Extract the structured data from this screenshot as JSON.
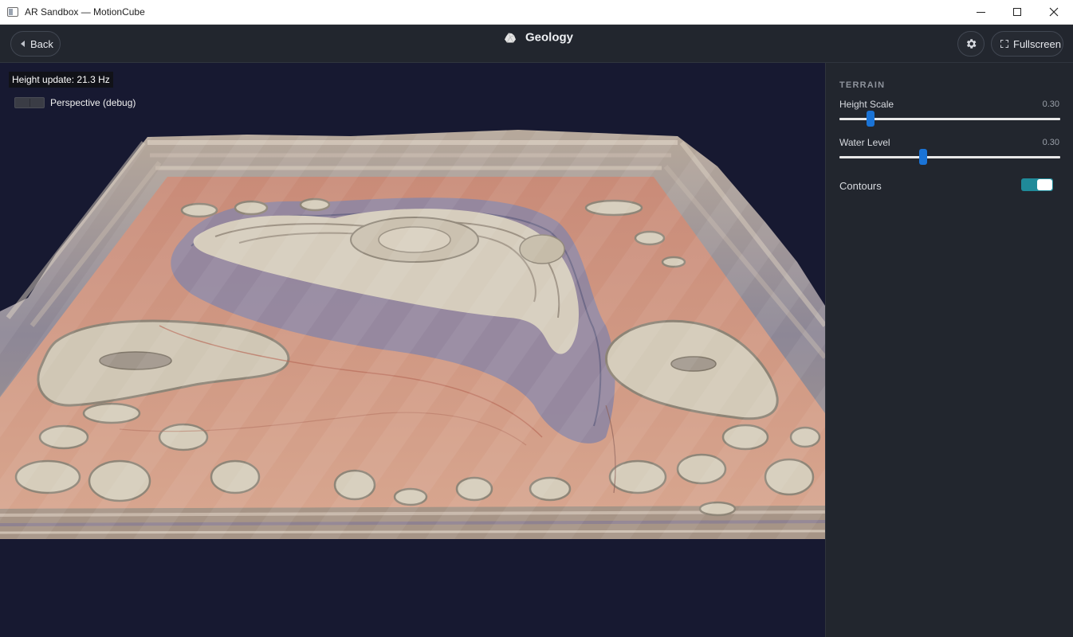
{
  "window": {
    "title": "AR Sandbox — MotionCube"
  },
  "header": {
    "back_label": "Back",
    "title": "Geology",
    "title_icon": "rock-icon",
    "settings_icon": "gear-icon",
    "fullscreen_label": "Fullscreen"
  },
  "viewport": {
    "height_update": "Height update: 21.3 Hz",
    "perspective_label": "Perspective (debug)",
    "perspective_enabled": false
  },
  "panel": {
    "section_title": "TERRAIN",
    "sliders": [
      {
        "label": "Height Scale",
        "value": "0.30",
        "fraction": 0.14
      },
      {
        "label": "Water Level",
        "value": "0.30",
        "fraction": 0.38
      }
    ],
    "contours_label": "Contours",
    "contours_enabled": true
  },
  "colors": {
    "accent": "#1a73d6",
    "toggle_on": "#1f8a99",
    "background": "#171931",
    "panel": "#22262e"
  }
}
